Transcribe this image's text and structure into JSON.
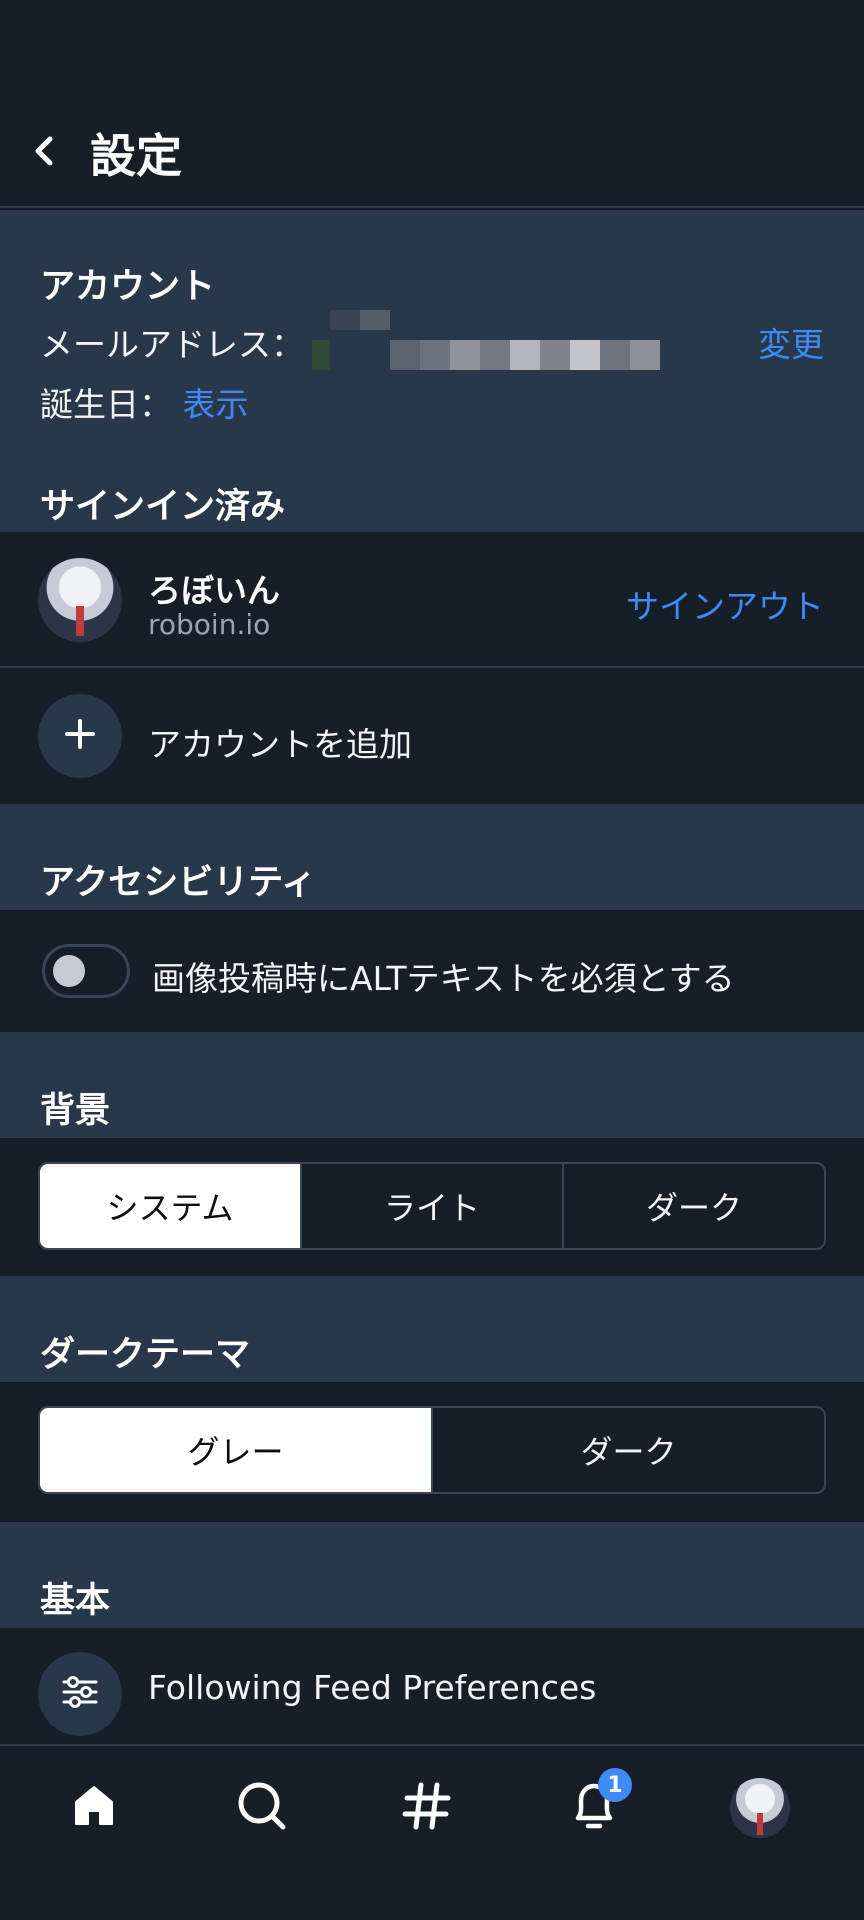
{
  "header": {
    "title": "設定"
  },
  "account": {
    "section_title": "アカウント",
    "email_label": "メールアドレス：",
    "email_change": "変更",
    "birthday_label": "誕生日：",
    "birthday_show": "表示"
  },
  "signed_in": {
    "section_title": "サインイン済み",
    "user_name": "ろぼいん",
    "user_handle": "roboin.io",
    "sign_out": "サインアウト",
    "add_account": "アカウントを追加"
  },
  "accessibility": {
    "section_title": "アクセシビリティ",
    "alt_required_label": "画像投稿時にALTテキストを必須とする",
    "alt_required_on": false
  },
  "background": {
    "section_title": "背景",
    "options": [
      "システム",
      "ライト",
      "ダーク"
    ],
    "selected": "システム"
  },
  "dark_theme": {
    "section_title": "ダークテーマ",
    "options": [
      "グレー",
      "ダーク"
    ],
    "selected": "グレー"
  },
  "basic": {
    "section_title": "基本",
    "following_feed": "Following Feed Preferences"
  },
  "nav": {
    "items": [
      "home-icon",
      "search-icon",
      "hashtag-icon",
      "bell-icon",
      "profile-avatar"
    ],
    "notification_count": "1"
  },
  "colors": {
    "accent": "#3f8af7",
    "background": "#161e27",
    "section_background": "#29374a"
  }
}
